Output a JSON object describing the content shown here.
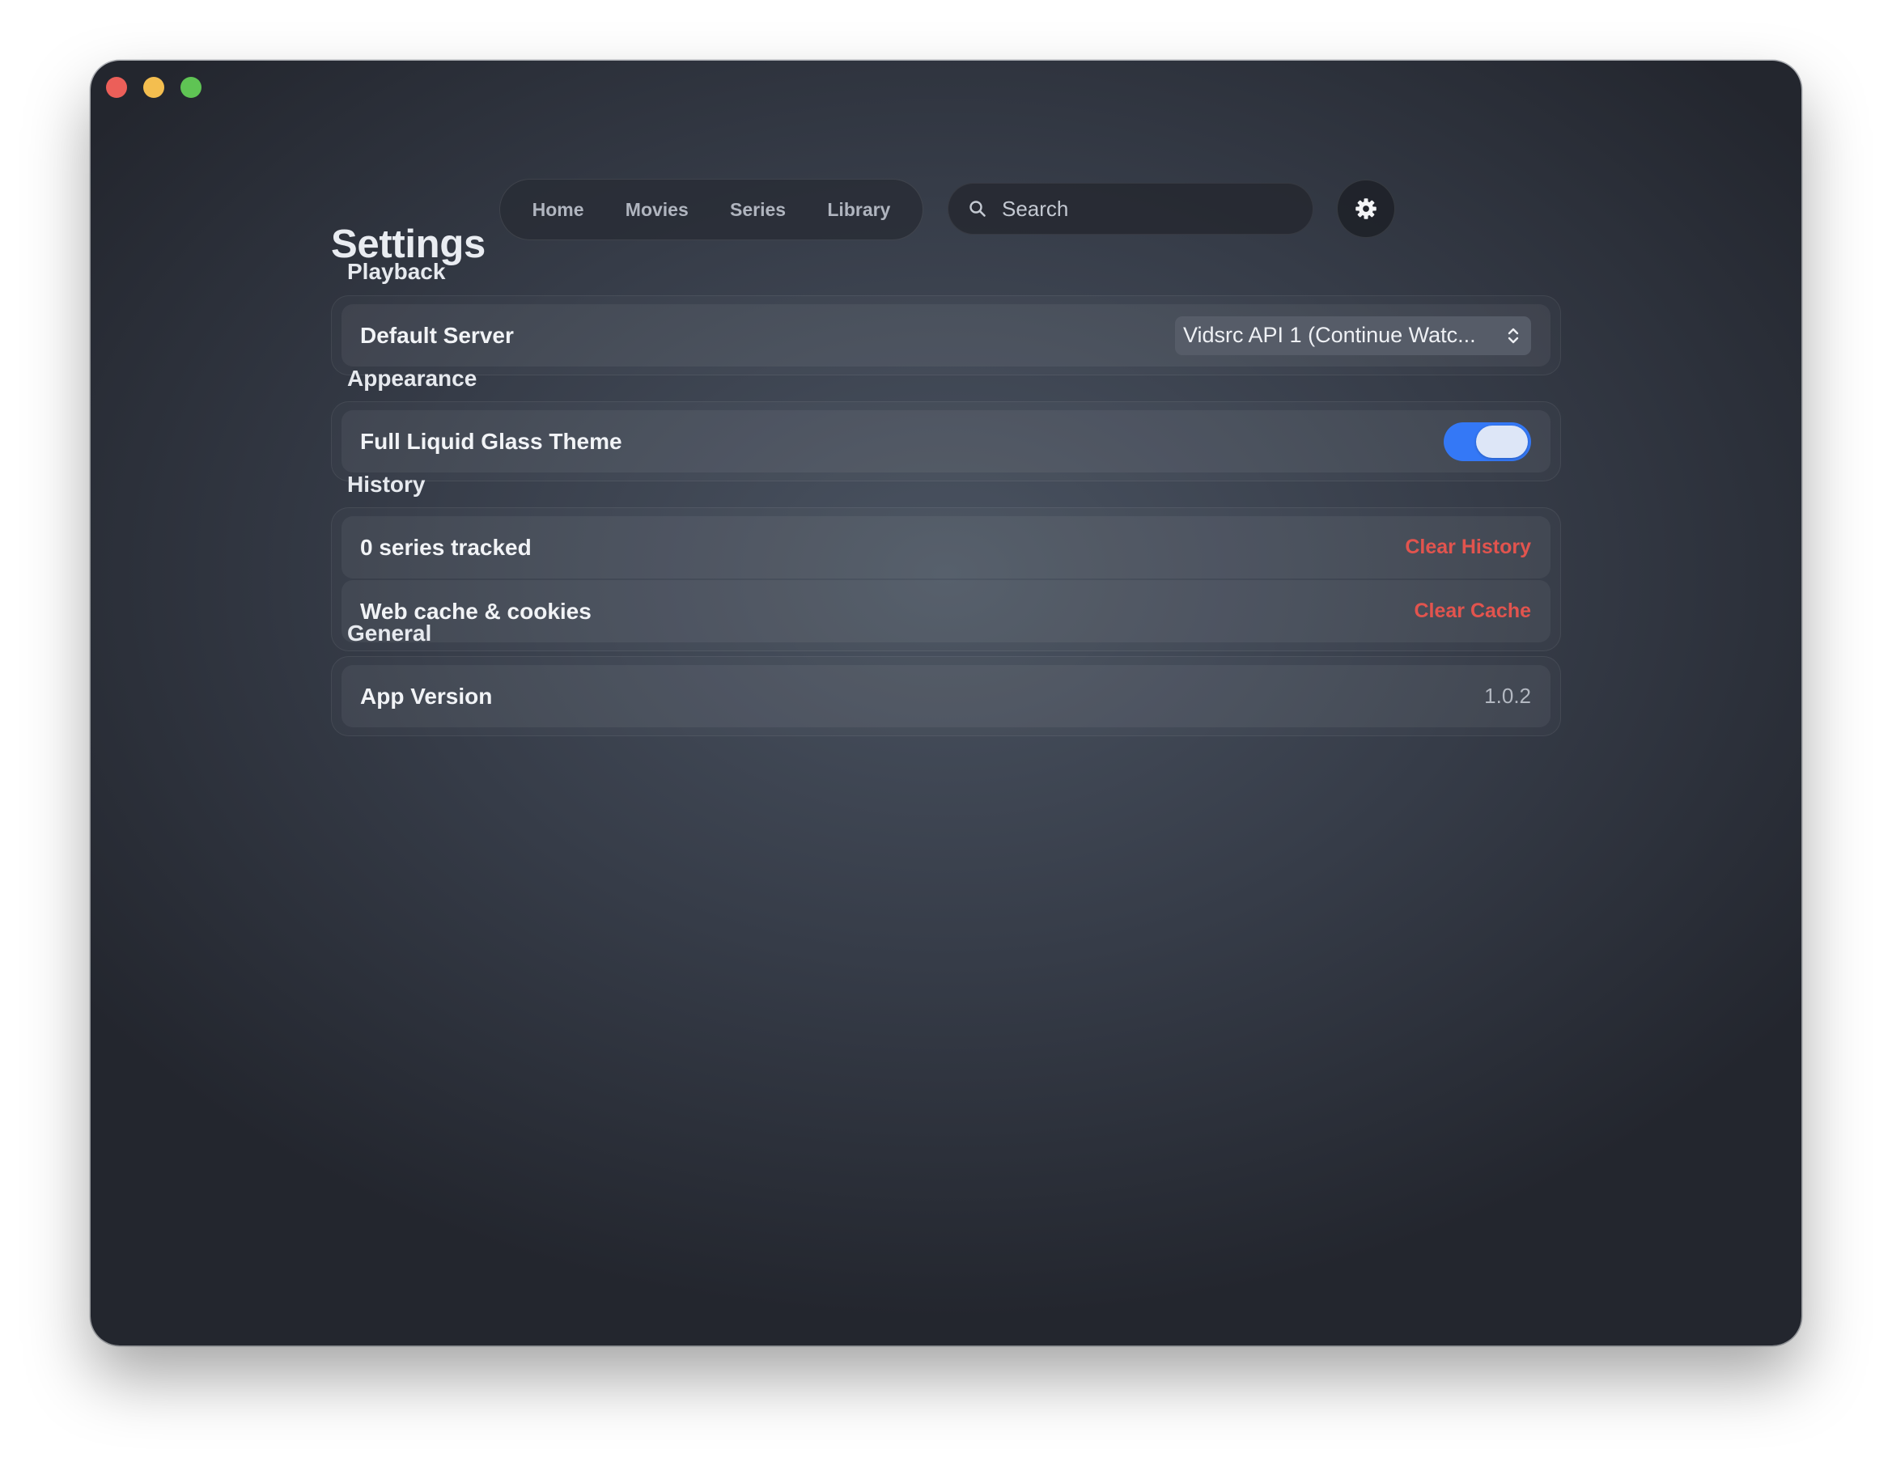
{
  "title": "Settings",
  "nav": {
    "items": [
      {
        "label": "Home"
      },
      {
        "label": "Movies"
      },
      {
        "label": "Series"
      },
      {
        "label": "Library"
      }
    ]
  },
  "search": {
    "placeholder": "Search",
    "icon": "magnifier-icon"
  },
  "settings_button": {
    "icon": "gear-icon"
  },
  "sections": {
    "playback": {
      "label": "Playback",
      "default_server": {
        "label": "Default Server",
        "value": "Vidsrc API 1 (Continue Watc..."
      }
    },
    "appearance": {
      "label": "Appearance",
      "liquid_glass": {
        "label": "Full Liquid Glass Theme",
        "enabled": true
      }
    },
    "history": {
      "label": "History",
      "series_tracked": {
        "label": "0 series tracked",
        "action": "Clear History"
      },
      "web_cache": {
        "label": "Web cache & cookies",
        "action": "Clear Cache"
      }
    },
    "general": {
      "label": "General",
      "app_version": {
        "label": "App Version",
        "value": "1.0.2"
      }
    }
  },
  "colors": {
    "accent": "#3478f6",
    "danger": "#e2544e",
    "traffic_close": "#ec5f59",
    "traffic_minimize": "#f4be4f",
    "traffic_maximize": "#5fc454"
  }
}
